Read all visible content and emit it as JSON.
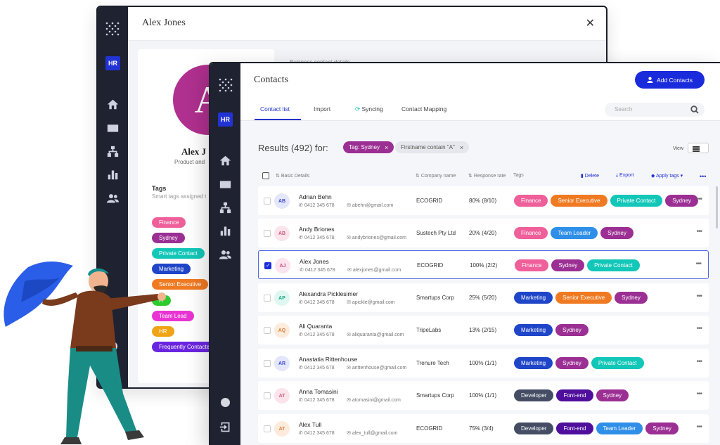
{
  "colors": {
    "finance": "#ef5f9a",
    "sydney": "#9b2f93",
    "private_contact": "#12c7b8",
    "marketing": "#1f45c8",
    "senior_executive": "#f07a22",
    "it": "#2ecb2e",
    "team_lead": "#e934d3",
    "hr": "#f0a415",
    "frequently_contacted": "#6a25e0",
    "team_leader": "#2f8fe8",
    "developer": "#444d63",
    "font_end": "#4f0f9c",
    "primary": "#1a2bdc",
    "sidebar": "#1f2231"
  },
  "back_window": {
    "title": "Alex Jones",
    "close_icon": "close-icon",
    "avatar_initial": "A",
    "name": "Alex J",
    "role": "Product and",
    "detail_hint": "Business contact details",
    "tags_title": "Tags",
    "tags_subtitle": "Smart tags assigned t",
    "hr_badge": "HR",
    "tags": [
      {
        "label": "Finance",
        "color": "#ef5f9a"
      },
      {
        "label": "Sydney",
        "color": "#9b2f93"
      },
      {
        "label": "Private Contact",
        "color": "#12c7b8"
      },
      {
        "label": "Marketing",
        "color": "#1f45c8"
      },
      {
        "label": "Senior Executive",
        "color": "#f07a22"
      },
      {
        "label": "IT",
        "color": "#2ecb2e"
      },
      {
        "label": "Team Lead",
        "color": "#e934d3"
      },
      {
        "label": "HR",
        "color": "#f0a415"
      },
      {
        "label": "Frequently Contacted",
        "color": "#6a25e0"
      }
    ]
  },
  "front_window": {
    "title": "Contacts",
    "add_button": "Add Contacts",
    "hr_badge": "HR",
    "tabs": [
      "Contact list",
      "Import",
      "Syncing",
      "Contact Mapping"
    ],
    "search_placeholder": "Search",
    "results_text": "Results (492) for:",
    "filters": [
      "Tag: Sydney",
      "Firstname contain \"A\""
    ],
    "view_label": "View",
    "columns": {
      "basic": "Basic Details",
      "company": "Company name",
      "response": "Response rate",
      "tags": "Tags",
      "delete": "Delete",
      "export": "Export",
      "apply_tags": "Apply tags"
    },
    "rows": [
      {
        "initials": "AB",
        "name": "Adrian Behn",
        "phone": "0412 345 678",
        "email": "abehn@gmail.com",
        "company": "ECOGRID",
        "rate": "80% (8/10)",
        "tags": [
          {
            "label": "Finance",
            "color": "#ef5f9a"
          },
          {
            "label": "Senior Executive",
            "color": "#f07a22"
          },
          {
            "label": "Private Contact",
            "color": "#12c7b8"
          },
          {
            "label": "Sydney",
            "color": "#9b2f93"
          }
        ],
        "av_bg": "#e4e6fb",
        "av_fg": "#3a4bd0"
      },
      {
        "initials": "AB",
        "name": "Andy Briones",
        "phone": "0412 345 678",
        "email": "andybriones@gmail.com",
        "company": "Sustech Pty Ltd",
        "rate": "20% (4/20)",
        "tags": [
          {
            "label": "Finance",
            "color": "#ef5f9a"
          },
          {
            "label": "Team Leader",
            "color": "#2f8fe8"
          },
          {
            "label": "Sydney",
            "color": "#9b2f93"
          }
        ],
        "av_bg": "#fce4ec",
        "av_fg": "#d05a7c"
      },
      {
        "initials": "AJ",
        "name": "Alex Jones",
        "phone": "0412 345 678",
        "email": "alexjones@gmail.com",
        "company": "ECOGRID",
        "rate": "100% (2/2)",
        "tags": [
          {
            "label": "Finance",
            "color": "#ef5f9a"
          },
          {
            "label": "Sydney",
            "color": "#9b2f93"
          },
          {
            "label": "Private Contact",
            "color": "#12c7b8"
          }
        ],
        "av_bg": "#fbe4ee",
        "av_fg": "#c44a7a"
      },
      {
        "initials": "AP",
        "name": "Alexandra Picklesimer",
        "phone": "0412 345 678",
        "email": "apickle@gmail.com",
        "company": "Smartups Corp",
        "rate": "25% (5/20)",
        "tags": [
          {
            "label": "Marketing",
            "color": "#1f45c8"
          },
          {
            "label": "Senior Executive",
            "color": "#f07a22"
          },
          {
            "label": "Sydney",
            "color": "#9b2f93"
          }
        ],
        "av_bg": "#dff7f1",
        "av_fg": "#1ea88a"
      },
      {
        "initials": "AQ",
        "name": "Ali Quaranta",
        "phone": "0412 345 678",
        "email": "aliquaranta@gmail.com",
        "company": "TripeLabs",
        "rate": "13% (2/15)",
        "tags": [
          {
            "label": "Marketing",
            "color": "#1f45c8"
          },
          {
            "label": "Sydney",
            "color": "#9b2f93"
          }
        ],
        "av_bg": "#fdebdc",
        "av_fg": "#d9803c"
      },
      {
        "initials": "AR",
        "name": "Anastatia Rittenhouse",
        "phone": "0412 345 678",
        "email": "arittenhouse@gmail.com",
        "company": "Trenure Tech",
        "rate": "100% (1/1)",
        "tags": [
          {
            "label": "Marketing",
            "color": "#1f45c8"
          },
          {
            "label": "Sydney",
            "color": "#9b2f93"
          },
          {
            "label": "Private Contact",
            "color": "#12c7b8"
          }
        ],
        "av_bg": "#e4e6fb",
        "av_fg": "#3a4bd0"
      },
      {
        "initials": "AT",
        "name": "Anna Tomasini",
        "phone": "0412 345 678",
        "email": "atomasini@gmail.com",
        "company": "Smartups Corp",
        "rate": "100% (1/1)",
        "tags": [
          {
            "label": "Developer",
            "color": "#444d63"
          },
          {
            "label": "Font-end",
            "color": "#4f0f9c"
          },
          {
            "label": "Sydney",
            "color": "#9b2f93"
          }
        ],
        "av_bg": "#fce4ec",
        "av_fg": "#d05a7c"
      },
      {
        "initials": "AT",
        "name": "Alex Tull",
        "phone": "0412 345 678",
        "email": "alex_tull@gmail.com",
        "company": "ECOGRID",
        "rate": "75% (3/4)",
        "tags": [
          {
            "label": "Developer",
            "color": "#444d63"
          },
          {
            "label": "Font-end",
            "color": "#4f0f9c"
          },
          {
            "label": "Team Leader",
            "color": "#2f8fe8"
          },
          {
            "label": "Sydney",
            "color": "#9b2f93"
          }
        ],
        "av_bg": "#fdebdc",
        "av_fg": "#d9803c"
      }
    ],
    "selected_row": 2
  },
  "icons": [
    "logo-icon",
    "home-icon",
    "mail-icon",
    "org-chart-icon",
    "bar-chart-icon",
    "people-icon",
    "logout-icon",
    "search-icon",
    "add-user-icon",
    "sync-icon",
    "trash-icon",
    "export-icon",
    "tag-icon",
    "list-view-icon",
    "more-icon"
  ]
}
